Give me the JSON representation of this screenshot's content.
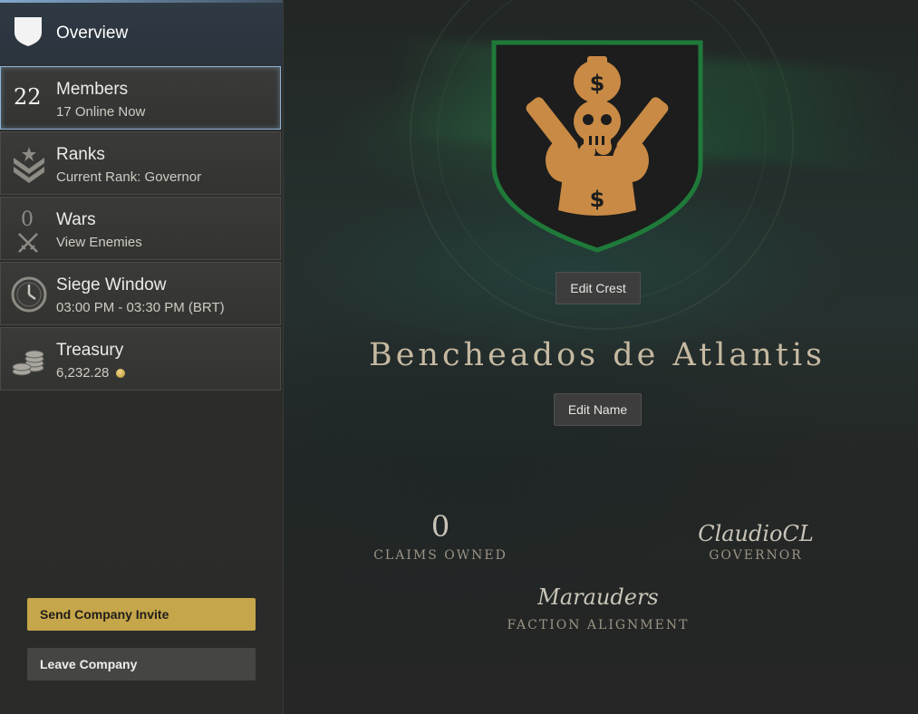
{
  "sidebar": {
    "overview": {
      "label": "Overview",
      "icon": "shield-icon"
    },
    "items": [
      {
        "id": "members",
        "count": "22",
        "title": "Members",
        "subtitle": "17 Online Now"
      },
      {
        "id": "ranks",
        "icon": "chevron-rank-icon",
        "title": "Ranks",
        "subtitle": "Current Rank: Governor"
      },
      {
        "id": "wars",
        "count": "0",
        "icon": "crossed-swords-icon",
        "title": "Wars",
        "subtitle": "View Enemies"
      },
      {
        "id": "siege",
        "icon": "clock-icon",
        "title": "Siege Window",
        "subtitle": "03:00 PM - 03:30 PM  (BRT)"
      },
      {
        "id": "treasury",
        "icon": "coin-stack-icon",
        "title": "Treasury",
        "subtitle": "6,232.28"
      }
    ],
    "invite_button": "Send Company Invite",
    "leave_button": "Leave Company"
  },
  "main": {
    "edit_crest_button": "Edit Crest",
    "company_name": "Bencheados de Atlantis",
    "edit_name_button": "Edit Name",
    "claims": {
      "value": "0",
      "label": "CLAIMS OWNED"
    },
    "governor": {
      "value": "ClaudioCL",
      "label": "GOVERNOR"
    },
    "faction": {
      "value": "Marauders",
      "label": "FACTION ALIGNMENT"
    }
  },
  "colors": {
    "crest_border": "#1f7a3a",
    "crest_fill": "#1c1d1c",
    "crest_emblem": "#c98a45",
    "accent_gold": "#c6a64a",
    "active_border": "#8fb3d6"
  }
}
